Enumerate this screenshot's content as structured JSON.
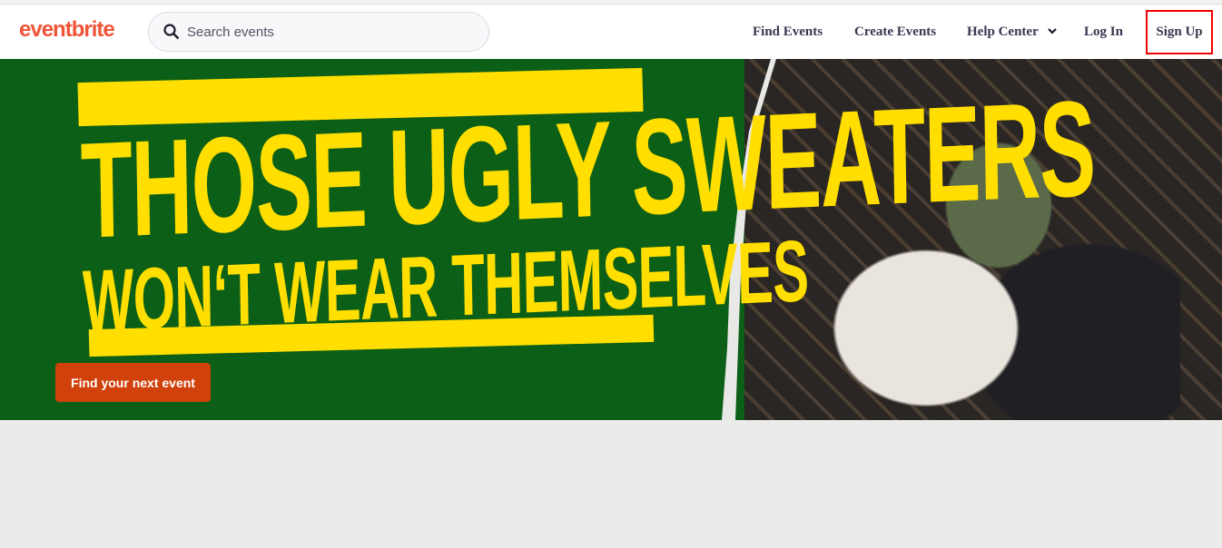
{
  "header": {
    "logo": "eventbrite",
    "search": {
      "placeholder": "Search events",
      "value": ""
    },
    "nav": [
      {
        "label": "Find Events"
      },
      {
        "label": "Create Events"
      },
      {
        "label": "Help Center",
        "icon": "chevron-down-icon"
      },
      {
        "label": "Log In"
      },
      {
        "label": "Sign Up",
        "highlighted": true
      }
    ]
  },
  "hero": {
    "headline_line1": "THOSE UGLY SWEATERS",
    "headline_line2": "WON‘T WEAR THEMSELVES",
    "cta_label": "Find your next event"
  },
  "colors": {
    "brand": "#f05537",
    "hero_bg": "#0c5f16",
    "headline": "#ffde00",
    "cta": "#d1410c",
    "highlight_box": "#ee0000"
  }
}
